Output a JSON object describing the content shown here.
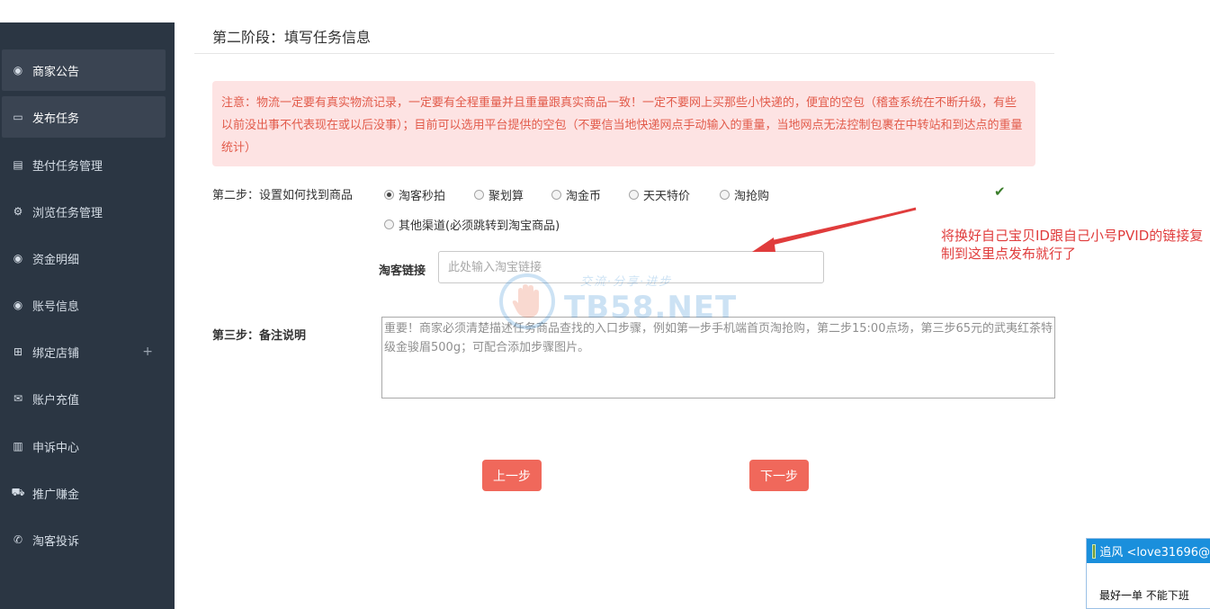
{
  "sidebar": {
    "items": [
      {
        "label": "商家公告",
        "icon": "dashboard-icon",
        "glyph": "◉",
        "active": true
      },
      {
        "label": "发布任务",
        "icon": "laptop-icon",
        "glyph": "▭",
        "active": true
      },
      {
        "label": "垫付任务管理",
        "icon": "book-icon",
        "glyph": "▤",
        "active": false
      },
      {
        "label": "浏览任务管理",
        "icon": "cogs-icon",
        "glyph": "⚙",
        "active": false
      },
      {
        "label": "资金明细",
        "icon": "dashboard-icon",
        "glyph": "◉",
        "active": false
      },
      {
        "label": "账号信息",
        "icon": "dashboard-icon",
        "glyph": "◉",
        "active": false
      },
      {
        "label": "绑定店铺",
        "icon": "sitemap-icon",
        "glyph": "⊞",
        "active": false,
        "expand": "+"
      },
      {
        "label": "账户充值",
        "icon": "envelope-icon",
        "glyph": "✉",
        "active": false
      },
      {
        "label": "申诉中心",
        "icon": "bar-chart-icon",
        "glyph": "▥",
        "active": false
      },
      {
        "label": "推广赚金",
        "icon": "cart-icon",
        "glyph": "⛟",
        "active": false
      },
      {
        "label": "淘客投诉",
        "icon": "phone-icon",
        "glyph": "✆",
        "active": false
      }
    ]
  },
  "main": {
    "stage_title": "第二阶段：填写任务信息",
    "notice": "注意：物流一定要有真实物流记录，一定要有全程重量并且重量跟真实商品一致！一定不要网上买那些小快递的，便宜的空包（稽查系统在不断升级，有些以前没出事不代表现在或以后没事）；目前可以选用平台提供的空包（不要信当地快递网点手动输入的重量，当地网点无法控制包裹在中转站和到达点的重量统计）",
    "step2_label": "第二步：设置如何找到商品",
    "channels": [
      {
        "label": "淘客秒拍",
        "checked": true
      },
      {
        "label": "聚划算",
        "checked": false
      },
      {
        "label": "淘金币",
        "checked": false
      },
      {
        "label": "天天特价",
        "checked": false
      },
      {
        "label": "淘抢购",
        "checked": false
      },
      {
        "label": "其他渠道(必须跳转到淘宝商品)",
        "checked": false
      }
    ],
    "link_label": "淘客链接",
    "link_placeholder": "此处输入淘宝链接",
    "step3_label": "第三步：备注说明",
    "remark_placeholder": "重要！商家必须清楚描述任务商品查找的入口步骤，例如第一步手机端首页淘抢购，第二步15:00点场，第三步65元的武夷红茶特级金骏眉500g；可配合添加步骤图片。",
    "prev_button": "上一步",
    "next_button": "下一步"
  },
  "annotation": {
    "text": "将换好自己宝贝ID跟自己小号PVID的链接复制到这里点发布就行了",
    "color": "#e03c3c"
  },
  "watermark": {
    "text": "TB58.NET",
    "sub": "交流·分享·进步"
  },
  "chat": {
    "sender": "追风 <love31696@",
    "message": "最好一单  不能下班"
  },
  "colors": {
    "sidebar_bg": "#2b3643",
    "accent_button": "#f0685b",
    "notice_bg": "#fde3e3",
    "notice_text": "#e25b4b",
    "check_green": "#3a7d2a"
  }
}
